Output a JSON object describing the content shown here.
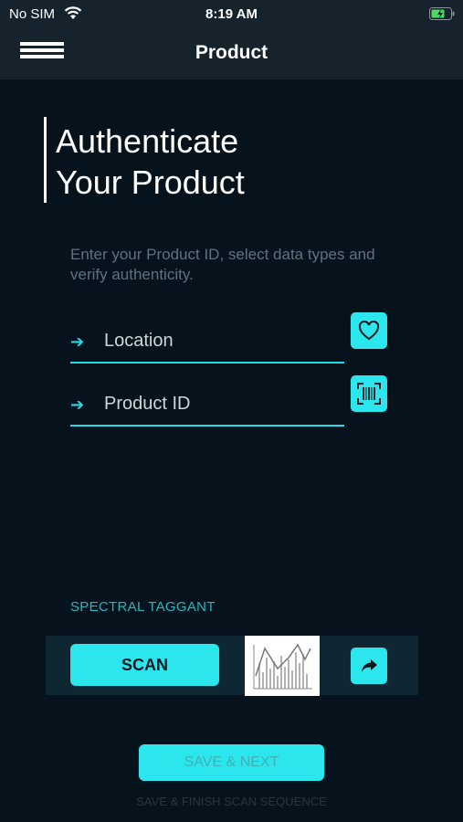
{
  "status_bar": {
    "carrier": "No SIM",
    "time": "8:19 AM"
  },
  "nav": {
    "title": "Product"
  },
  "hero": {
    "line1": "Authenticate",
    "line2": "Your Product"
  },
  "subtitle": "Enter your Product ID, select data types and verify authenticity.",
  "fields": {
    "location": {
      "label": "Location"
    },
    "product_id": {
      "label": "Product ID"
    }
  },
  "spectral": {
    "label": "SPECTRAL TAGGANT",
    "scan_label": "SCAN"
  },
  "footer": {
    "save_label": "SAVE & NEXT",
    "finish_label": "SAVE & FINISH SCAN SEQUENCE"
  },
  "colors": {
    "accent": "#2ce6ee",
    "background": "#07131c",
    "bar": "#16232d"
  },
  "icons": [
    "menu-icon",
    "heart-icon",
    "barcode-icon",
    "share-icon",
    "wifi-icon",
    "battery-icon"
  ]
}
